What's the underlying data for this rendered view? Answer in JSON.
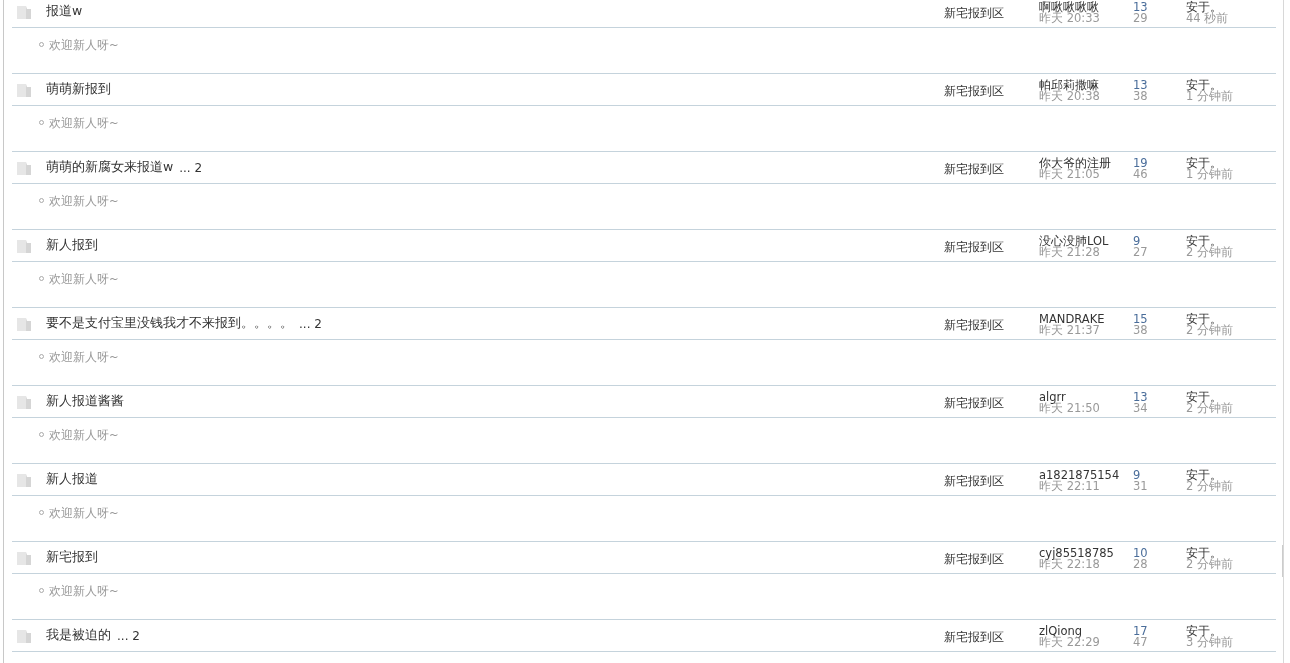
{
  "threads": [
    {
      "title": "报道w",
      "forum": "新宅报到区",
      "author": "啊啾啾啾啾",
      "date": "昨天 20:33",
      "replies": "13",
      "views": "29",
      "last_user": "安于。",
      "last_time": "44 秒前",
      "preview": "欢迎新人呀~"
    },
    {
      "title": "萌萌新报到",
      "forum": "新宅报到区",
      "author": "帕邱莉撒嘛",
      "date": "昨天 20:38",
      "replies": "13",
      "views": "38",
      "last_user": "安于。",
      "last_time": "1 分钟前",
      "preview": "欢迎新人呀~"
    },
    {
      "title": "萌萌的新腐女来报道w",
      "pages": "... 2",
      "forum": "新宅报到区",
      "author": "你大爷的注册",
      "date": "昨天 21:05",
      "replies": "19",
      "views": "46",
      "last_user": "安于。",
      "last_time": "1 分钟前",
      "preview": "欢迎新人呀~"
    },
    {
      "title": "新人报到",
      "forum": "新宅报到区",
      "author": "没心没肺LOL",
      "date": "昨天 21:28",
      "replies": "9",
      "views": "27",
      "last_user": "安于。",
      "last_time": "2 分钟前",
      "preview": "欢迎新人呀~"
    },
    {
      "title": "要不是支付宝里没钱我才不来报到。。。。",
      "pages": "... 2",
      "forum": "新宅报到区",
      "author": "MANDRAKE",
      "date": "昨天 21:37",
      "replies": "15",
      "views": "38",
      "last_user": "安于。",
      "last_time": "2 分钟前",
      "preview": "欢迎新人呀~"
    },
    {
      "title": "新人报道酱酱",
      "forum": "新宅报到区",
      "author": "algrr",
      "date": "昨天 21:50",
      "replies": "13",
      "views": "34",
      "last_user": "安于。",
      "last_time": "2 分钟前",
      "preview": "欢迎新人呀~"
    },
    {
      "title": "新人报道",
      "forum": "新宅报到区",
      "author": "a1821875154",
      "date": "昨天 22:11",
      "replies": "9",
      "views": "31",
      "last_user": "安于。",
      "last_time": "2 分钟前",
      "preview": "欢迎新人呀~"
    },
    {
      "title": "新宅报到",
      "forum": "新宅报到区",
      "author": "cyj85518785",
      "date": "昨天 22:18",
      "replies": "10",
      "views": "28",
      "last_user": "安于。",
      "last_time": "2 分钟前",
      "preview": "欢迎新人呀~"
    },
    {
      "title": "我是被迫的",
      "pages": "... 2",
      "forum": "新宅报到区",
      "author": "zlQiong",
      "date": "昨天 22:29",
      "replies": "17",
      "views": "47",
      "last_user": "安于。",
      "last_time": "3 分钟前"
    }
  ]
}
